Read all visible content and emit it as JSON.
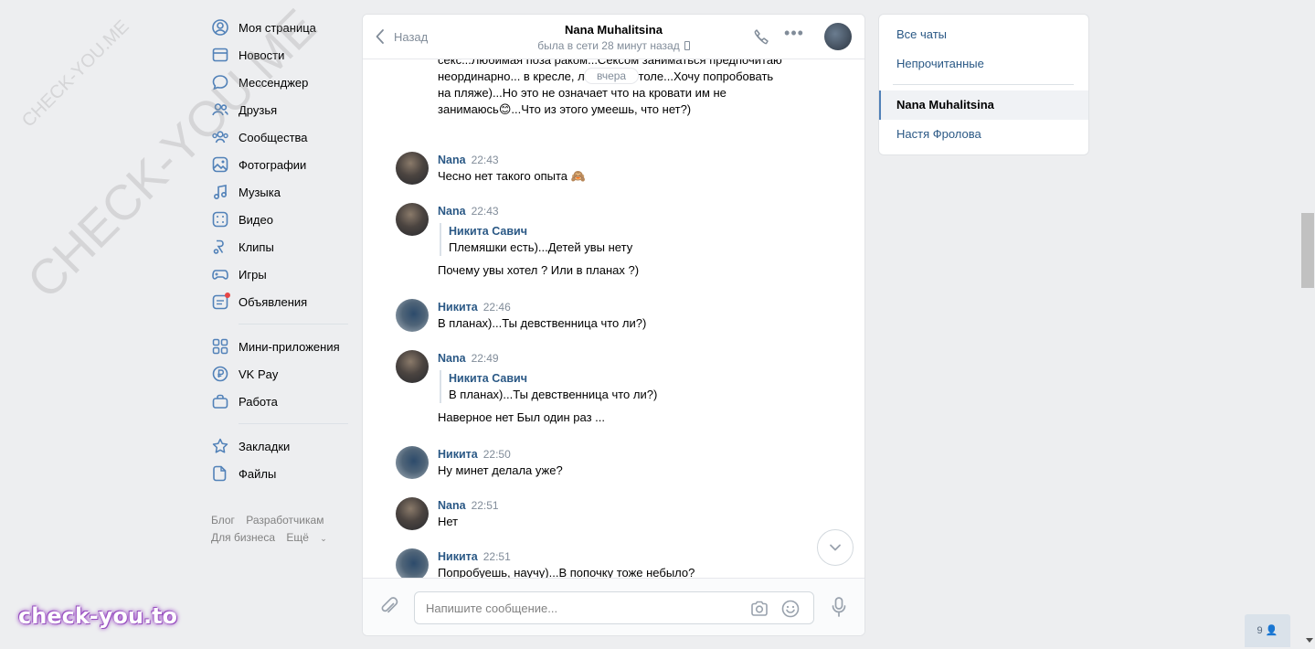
{
  "nav": {
    "items": [
      {
        "label": "Моя страница",
        "icon": "user-circle-icon"
      },
      {
        "label": "Новости",
        "icon": "newspaper-icon"
      },
      {
        "label": "Мессенджер",
        "icon": "message-bubble-icon"
      },
      {
        "label": "Друзья",
        "icon": "friends-icon"
      },
      {
        "label": "Сообщества",
        "icon": "communities-icon"
      },
      {
        "label": "Фотографии",
        "icon": "photo-icon"
      },
      {
        "label": "Музыка",
        "icon": "music-note-icon"
      },
      {
        "label": "Видео",
        "icon": "video-icon"
      },
      {
        "label": "Клипы",
        "icon": "clips-icon"
      },
      {
        "label": "Игры",
        "icon": "gamepad-icon"
      },
      {
        "label": "Объявления",
        "icon": "ads-icon"
      }
    ],
    "items2": [
      {
        "label": "Мини-приложения",
        "icon": "apps-grid-icon"
      },
      {
        "label": "VK Pay",
        "icon": "vkpay-icon"
      },
      {
        "label": "Работа",
        "icon": "briefcase-icon"
      }
    ],
    "items3": [
      {
        "label": "Закладки",
        "icon": "star-icon"
      },
      {
        "label": "Файлы",
        "icon": "file-icon"
      }
    ],
    "footer": {
      "blog": "Блог",
      "developers": "Разработчикам",
      "business": "Для бизнеса",
      "more": "Ещё"
    }
  },
  "chat": {
    "back_label": "Назад",
    "peer_name": "Nana Muhalitsina",
    "peer_status": "была в сети 28 минут назад",
    "date_pill": "вчера",
    "continuation_text": "секс...Любимая поза раком...Сексом заниматься предпочитаю неординарно... в кресле, лифте,на столе...Хочу попробовать на пляже)...Но это не означает что на кровати им не занимаюсь😊...Что из этого умеешь, что нет?)",
    "messages": [
      {
        "author": "Nana",
        "time": "22:43",
        "text": "Чесно нет такого опыта 🙈"
      },
      {
        "author": "Nana",
        "time": "22:43",
        "quote_author": "Никита Савич",
        "quote_text": "Племяшки есть)...Детей увы нету",
        "text": "Почему увы хотел ? Или в планах ?)"
      },
      {
        "author": "Никита",
        "time": "22:46",
        "text": "В планах)...Ты девственница что ли?)"
      },
      {
        "author": "Nana",
        "time": "22:49",
        "quote_author": "Никита Савич",
        "quote_text": "В планах)...Ты девственница что ли?)",
        "text": "Наверное нет Был один раз ..."
      },
      {
        "author": "Никита",
        "time": "22:50",
        "text": "Ну минет делала уже?"
      },
      {
        "author": "Nana",
        "time": "22:51",
        "text": "Нет"
      },
      {
        "author": "Никита",
        "time": "22:51",
        "text": "Попробуешь, научу)...В попочку тоже небыло?"
      }
    ],
    "input_placeholder": "Напишите сообщение..."
  },
  "right": {
    "all_chats": "Все чаты",
    "unread": "Непрочитанные",
    "chats": [
      "Nana Muhalitsina",
      "Настя Фролова"
    ]
  },
  "online_count": "9",
  "watermark": {
    "logo": "check-you.to",
    "diag_big": "CHECK-YOU.ME",
    "diag_small": "CHECK-YOU.ME"
  },
  "colors": {
    "link": "#2a5885",
    "background": "#edeef0",
    "secondary": "#818c99"
  }
}
